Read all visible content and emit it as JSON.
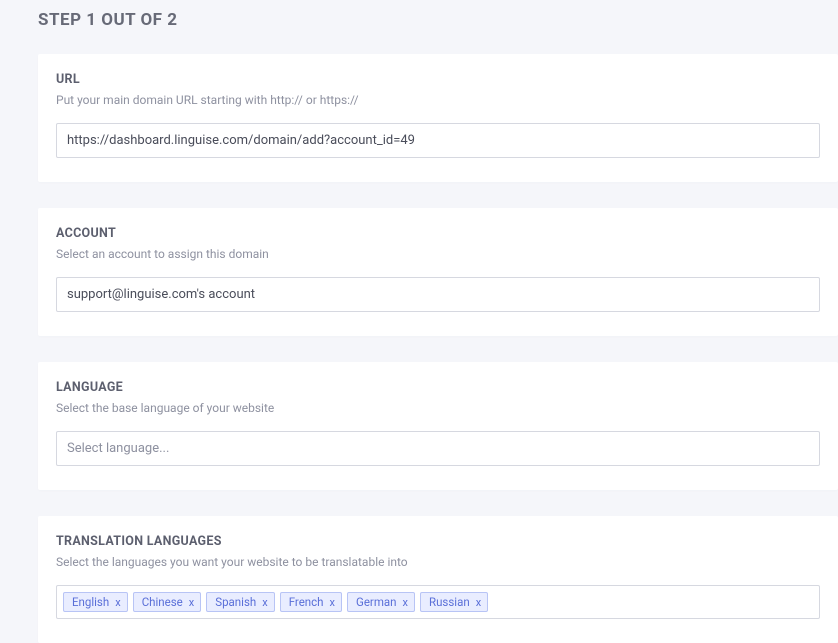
{
  "step_header": "STEP 1 OUT OF 2",
  "url": {
    "title": "URL",
    "desc": "Put your main domain URL starting with http:// or https://",
    "value": "https://dashboard.linguise.com/domain/add?account_id=49"
  },
  "account": {
    "title": "ACCOUNT",
    "desc": "Select an account to assign this domain",
    "value": "support@linguise.com's account"
  },
  "language": {
    "title": "LANGUAGE",
    "desc": "Select the base language of your website",
    "placeholder": "Select language..."
  },
  "translation": {
    "title": "TRANSLATION LANGUAGES",
    "desc": "Select the languages you want your website to be translatable into",
    "tags": [
      "English",
      "Chinese",
      "Spanish",
      "French",
      "German",
      "Russian"
    ]
  }
}
